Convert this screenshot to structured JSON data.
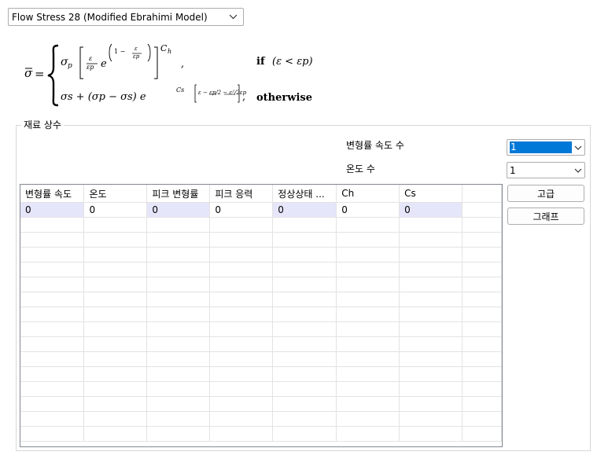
{
  "model_select": {
    "value": "Flow Stress 28 (Modified Ebrahimi Model)"
  },
  "formula": {
    "lhs": "σ",
    "case1_sigma": "σ",
    "case1_sub": "p",
    "case1_frac_num": "ε",
    "case1_frac_den": "εp",
    "case1_e": "e",
    "case1_exp_lead": "1 −",
    "case1_exp_num": "ε",
    "case1_exp_den": "εp",
    "case1_power": "C",
    "case1_power_sub": "h",
    "case1_comma": ",",
    "case1_cond": "if",
    "case1_cond_expr": "(ε < εp)",
    "case2_text": "σs + (σp − σs) e",
    "case2_exp_c": "Cs",
    "case2_exp_expr": "ε − εp/2 − ε²/2εp",
    "case2_comma": ",",
    "case2_cond": "otherwise"
  },
  "material_constants": {
    "title": "재료 상수",
    "strain_rate_count_label": "변형률 속도 수",
    "strain_rate_count_value": "1",
    "temperature_count_label": "온도 수",
    "temperature_count_value": "1",
    "advanced_button": "고급",
    "graph_button": "그래프"
  },
  "table": {
    "columns": [
      "변형률 속도",
      "온도",
      "피크 변형률",
      "피크 응력",
      "정상상태 ...",
      "Ch",
      "Cs",
      ""
    ],
    "rows": [
      [
        "0",
        "0",
        "0",
        "0",
        "0",
        "0",
        "0",
        ""
      ]
    ],
    "highlighted_columns": [
      0,
      2,
      4,
      6
    ],
    "empty_rows": 15
  },
  "colors": {
    "selection": "#0078d7",
    "cell_highlight": "#e6e6fa",
    "grid_border": "#828790"
  }
}
